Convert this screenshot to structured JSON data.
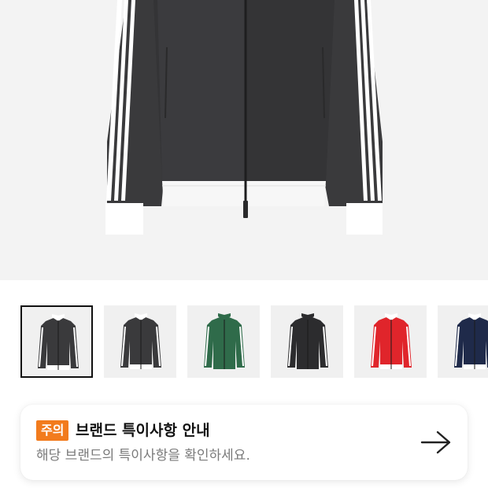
{
  "product": {
    "image_icon": "track-jacket-black-image",
    "colors": {
      "jacket": "#3a3a3c",
      "stripe": "#ffffff",
      "cuff": "#ffffff",
      "background": "#f3f3f3"
    }
  },
  "thumbnails": [
    {
      "name": "black-white-trim",
      "body": "#3a3a3c",
      "collar": "#ffffff",
      "stripe": "#ffffff",
      "hem": "#ffffff",
      "selected": true
    },
    {
      "name": "black-white-trim-alt",
      "body": "#3a3a3c",
      "collar": "#ffffff",
      "stripe": "#ffffff",
      "hem": "#ffffff",
      "selected": false
    },
    {
      "name": "green",
      "body": "#2f6b4a",
      "collar": "#2f6b4a",
      "stripe": "#ffffff",
      "hem": "#2f6b4a",
      "selected": false
    },
    {
      "name": "black-all",
      "body": "#2c2c2e",
      "collar": "#2c2c2e",
      "stripe": "#ffffff",
      "hem": "#2c2c2e",
      "selected": false
    },
    {
      "name": "red",
      "body": "#e0252b",
      "collar": "#ffffff",
      "stripe": "#ffffff",
      "hem": "#ffffff",
      "selected": false
    },
    {
      "name": "navy",
      "body": "#1f2a4a",
      "collar": "#ffffff",
      "stripe": "#ffffff",
      "hem": "#ffffff",
      "selected": false
    }
  ],
  "notice": {
    "badge": "주의",
    "title": "브랜드 특이사항 안내",
    "description": "해당 브랜드의 특이사항을 확인하세요.",
    "badge_color": "#f27b1d",
    "arrow_icon": "arrow-right-icon"
  }
}
